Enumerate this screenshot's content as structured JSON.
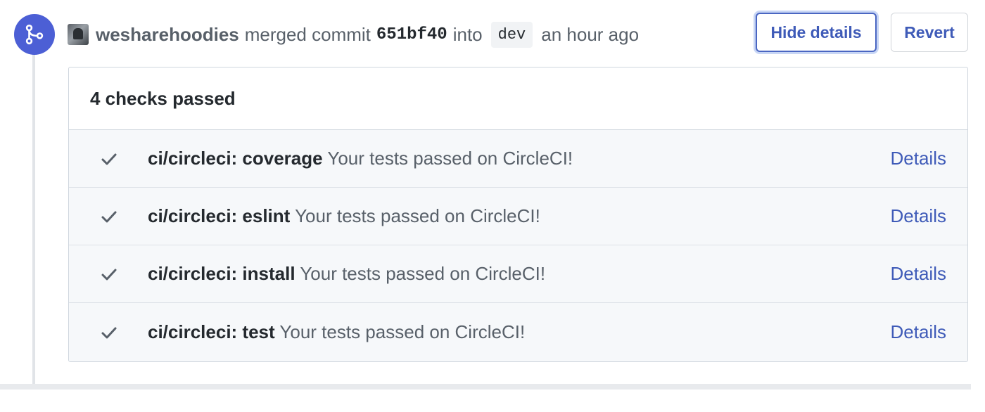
{
  "event": {
    "author": "wesharehoodies",
    "action": "merged commit",
    "commit_sha": "651bf40",
    "into_label": "into",
    "branch": "dev",
    "time_ago": "an hour ago"
  },
  "actions": {
    "hide_details_label": "Hide details",
    "revert_label": "Revert"
  },
  "checks": {
    "summary": "4 checks passed",
    "items": [
      {
        "name": "ci/circleci: coverage",
        "description": "Your tests passed on CircleCI!",
        "link": "Details"
      },
      {
        "name": "ci/circleci: eslint",
        "description": "Your tests passed on CircleCI!",
        "link": "Details"
      },
      {
        "name": "ci/circleci: install",
        "description": "Your tests passed on CircleCI!",
        "link": "Details"
      },
      {
        "name": "ci/circleci: test",
        "description": "Your tests passed on CircleCI!",
        "link": "Details"
      }
    ]
  },
  "icons": {
    "event": "git-merge-icon",
    "check": "check-icon"
  },
  "colors": {
    "merge_badge": "#4c5fd5",
    "link": "#3f5bb8",
    "row_bg": "#f6f8fa"
  }
}
